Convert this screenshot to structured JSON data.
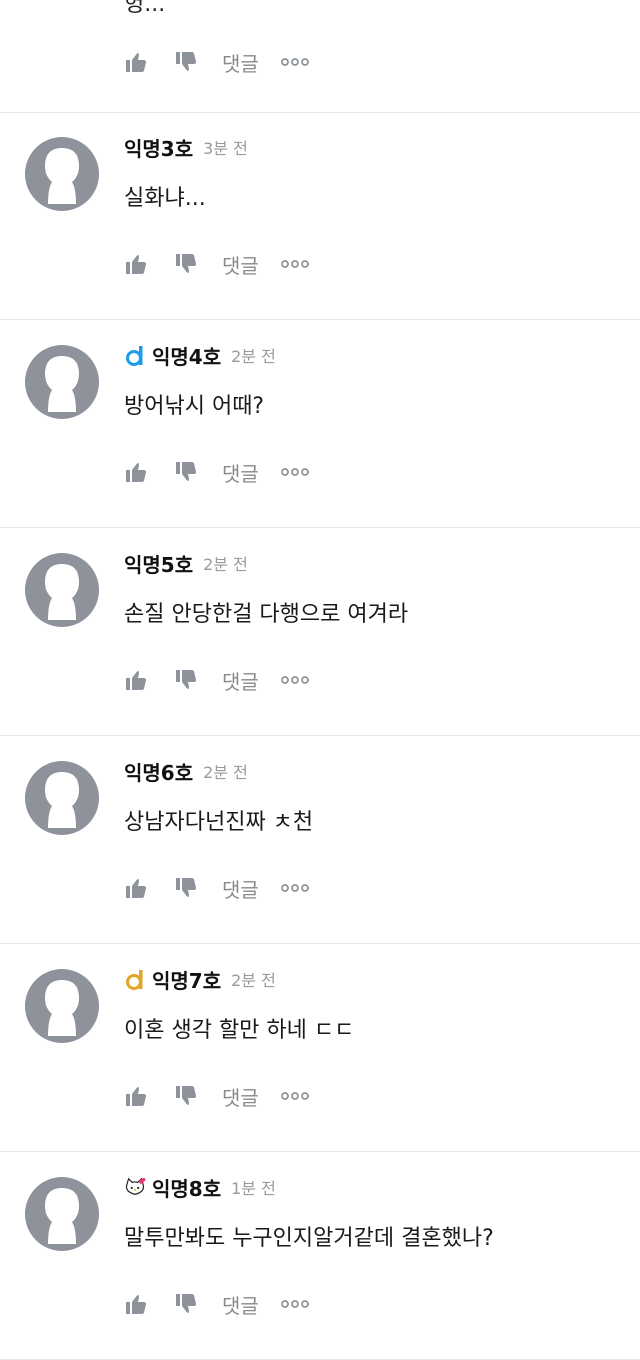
{
  "top_partial": {
    "text": "헝...",
    "actions": {
      "reply_label": "댓글"
    }
  },
  "comments": [
    {
      "name": "익명3호",
      "time": "3분 전",
      "badge": null,
      "text": "실화냐...",
      "reply_label": "댓글"
    },
    {
      "name": "익명4호",
      "time": "2분 전",
      "badge": "blue-d-badge-icon",
      "text": "방어낚시 어때?",
      "reply_label": "댓글"
    },
    {
      "name": "익명5호",
      "time": "2분 전",
      "badge": null,
      "text": "손질 안당한걸 다행으로 여겨라",
      "reply_label": "댓글"
    },
    {
      "name": "익명6호",
      "time": "2분 전",
      "badge": null,
      "text": "상남자다넌진짜 ㅊ천",
      "reply_label": "댓글"
    },
    {
      "name": "익명7호",
      "time": "2분 전",
      "badge": "gold-d-badge-icon",
      "text": "이혼 생각 할만 하네 ㄷㄷ",
      "reply_label": "댓글"
    },
    {
      "name": "익명8호",
      "time": "1분 전",
      "badge": "hello-kitty-badge-icon",
      "text": "말투만봐도 누구인지알거같데 결혼했나?",
      "reply_label": "댓글"
    }
  ],
  "colors": {
    "icon_gray": "#8e939b",
    "avatar_gray": "#8e939b",
    "divider": "#e6e6e6",
    "time_gray": "#9a9a9a",
    "badge_blue": "#1e9ce8",
    "badge_gold": "#e2a626"
  }
}
